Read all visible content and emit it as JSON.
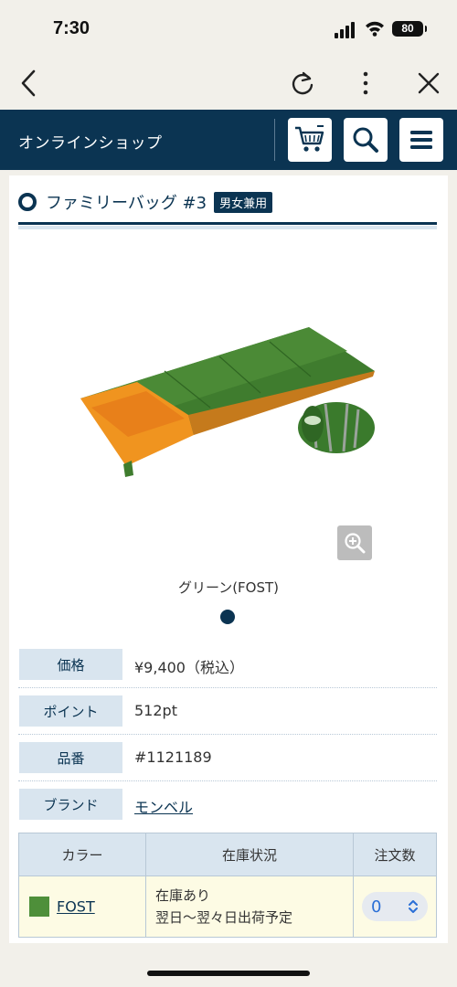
{
  "status_bar": {
    "time": "7:30",
    "battery": "80"
  },
  "header": {
    "site_title": "オンラインショップ"
  },
  "product": {
    "title": "ファミリーバッグ #3",
    "tag": "男女兼用",
    "color_caption": "グリーン(FOST)",
    "image_colors": {
      "shell": "#3f7c2e",
      "lining": "#f0941f",
      "stuff_sack": "#3a7a2c"
    }
  },
  "specs": [
    {
      "label": "価格",
      "value": "¥9,400（税込）"
    },
    {
      "label": "ポイント",
      "value": "512pt"
    },
    {
      "label": "品番",
      "value": "#1121189"
    },
    {
      "label": "ブランド",
      "value": "モンベル"
    }
  ],
  "stock_table": {
    "headers": [
      "カラー",
      "在庫状況",
      "注文数"
    ],
    "rows": [
      {
        "color_code": "FOST",
        "swatch": "#4e8f3a",
        "status_line1": "在庫あり",
        "status_line2": "翌日～翌々日出荷予定",
        "quantity": "0"
      }
    ]
  },
  "colors": {
    "navy": "#0b3452",
    "label_bg": "#d9e5ef",
    "row_bg": "#fdfbe4"
  }
}
